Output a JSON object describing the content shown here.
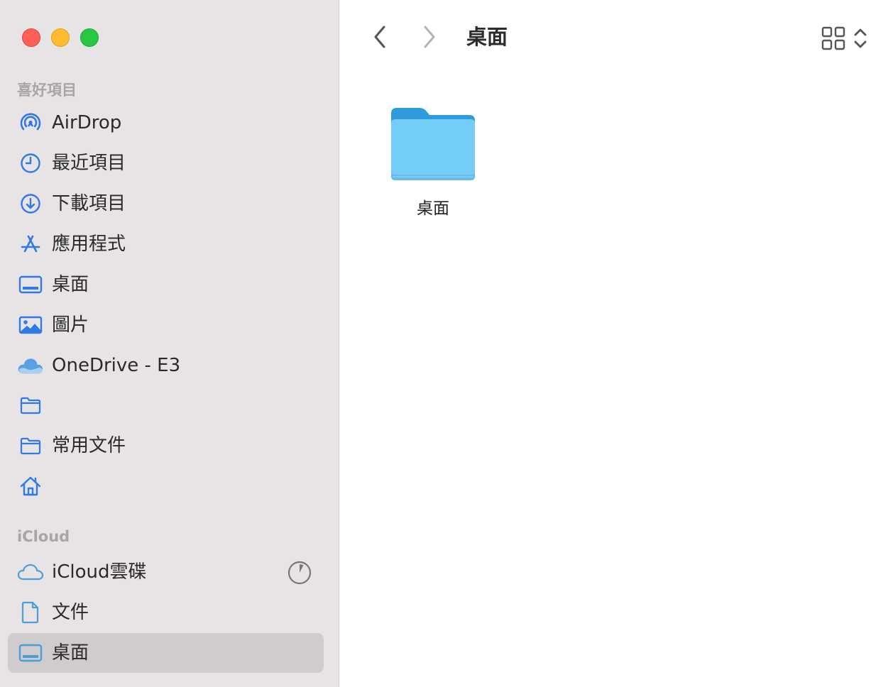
{
  "window": {
    "title": "桌面",
    "traffic_lights": {
      "close": "#fe5f57",
      "minimize": "#febc2e",
      "maximize": "#28c840"
    }
  },
  "sidebar": {
    "favorites_header": "喜好項目",
    "favorites": [
      {
        "label": "AirDrop",
        "icon": "airdrop-icon"
      },
      {
        "label": "最近項目",
        "icon": "clock-icon"
      },
      {
        "label": "下載項目",
        "icon": "download-icon"
      },
      {
        "label": "應用程式",
        "icon": "applications-icon"
      },
      {
        "label": "桌面",
        "icon": "desktop-icon"
      },
      {
        "label": "圖片",
        "icon": "photo-icon"
      },
      {
        "label": "OneDrive - E3",
        "icon": "onedrive-cloud-icon"
      },
      {
        "label": "",
        "icon": "folder-icon"
      },
      {
        "label": "常用文件",
        "icon": "folder-icon"
      },
      {
        "label": "",
        "icon": "home-icon"
      }
    ],
    "icloud_header": "iCloud",
    "icloud": [
      {
        "label": "iCloud雲碟",
        "icon": "icloud-icon",
        "status_icon": "sync-progress-icon"
      },
      {
        "label": "文件",
        "icon": "document-icon"
      },
      {
        "label": "桌面",
        "icon": "desktop-icon",
        "selected": true
      }
    ],
    "accent_color": "#2f7ae5",
    "icon_color_icloud": "#4a9fd8"
  },
  "toolbar": {
    "title": "桌面",
    "back_icon": "chevron-left-icon",
    "forward_icon": "chevron-right-icon",
    "view_icon": "grid-view-icon"
  },
  "content": {
    "items": [
      {
        "name": "桌面",
        "type": "folder",
        "color": "#6fc8f6"
      }
    ]
  }
}
